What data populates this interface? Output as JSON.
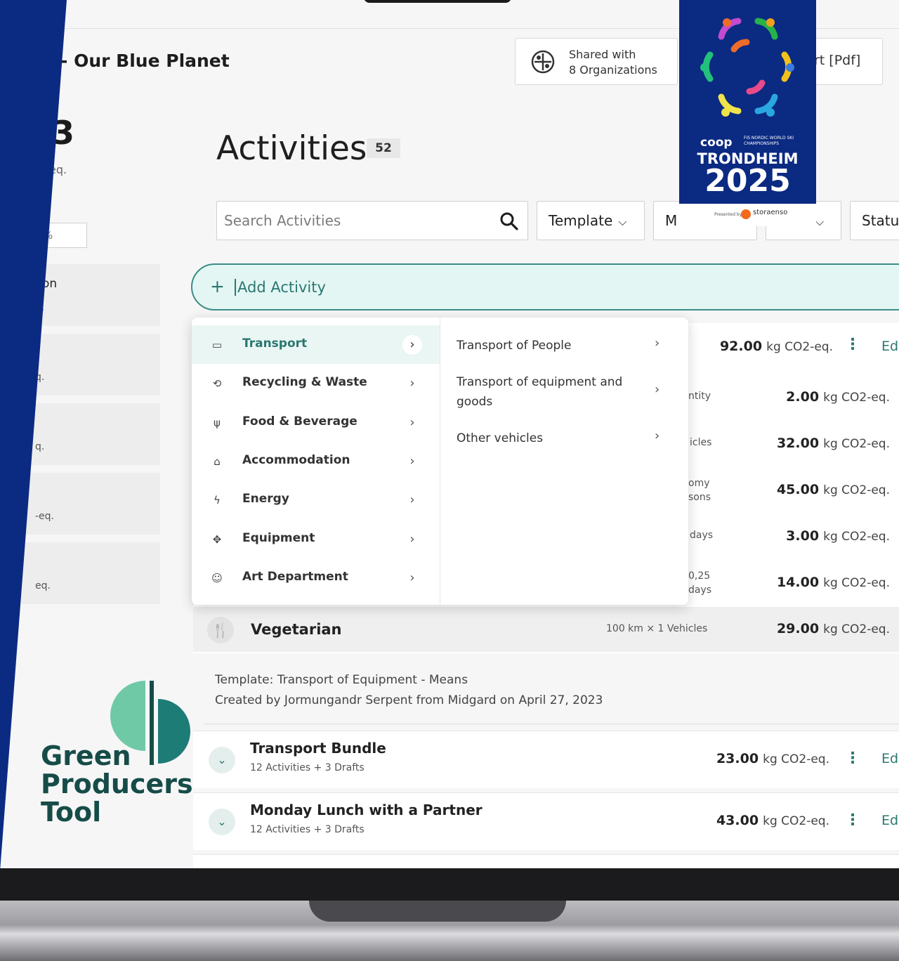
{
  "app": {
    "project_title": "- Our Blue Planet",
    "shared_line1": "Shared with",
    "shared_line2": "8 Organizations",
    "export_label": "rt [Pdf]"
  },
  "summary": {
    "big_number": "3",
    "unit": "eq.",
    "percent_box": "%",
    "cards": [
      {
        "title": "on",
        "sub": "q."
      },
      {
        "title": "",
        "sub": "q."
      },
      {
        "title": "",
        "sub": "q."
      },
      {
        "title": "",
        "sub": "-eq."
      },
      {
        "title": "",
        "sub": "eq."
      }
    ]
  },
  "activities": {
    "heading": "Activities",
    "count": "52",
    "search_placeholder": "Search Activities",
    "filters": {
      "template": "Template",
      "m": "M",
      "status": "Statu"
    },
    "add_label": "Add Activity",
    "header_row": {
      "value": "92.00",
      "unit": "kg CO2-eq.",
      "edit": "Ed"
    },
    "rows": [
      {
        "qty": "ntity",
        "value": "2.00",
        "unit": "kg CO2-eq."
      },
      {
        "qty": "icles",
        "value": "32.00",
        "unit": "kg CO2-eq."
      },
      {
        "qty": "omy\nsons",
        "value": "45.00",
        "unit": "kg CO2-eq."
      },
      {
        "qty": "days",
        "value": "3.00",
        "unit": "kg CO2-eq."
      },
      {
        "qty": "0,25\ndays",
        "value": "14.00",
        "unit": "kg CO2-eq."
      }
    ],
    "vegetarian": {
      "label": "Vegetarian",
      "qty": "100 km  × 1 Vehicles",
      "value": "29.00",
      "unit": "kg CO2-eq."
    },
    "template_info": {
      "line1": "Template: Transport of Equipment - Means",
      "line2": "Created by Jormungandr Serpent from Midgard on April 27, 2023"
    },
    "bundles": [
      {
        "title": "Transport Bundle",
        "sub": "12 Activities + 3 Drafts",
        "value": "23.00",
        "unit": "kg CO2-eq.",
        "edit": "Ed"
      },
      {
        "title": "Monday Lunch with a Partner",
        "sub": "12 Activities + 3 Drafts",
        "value": "43.00",
        "unit": "kg CO2-eq.",
        "edit": "Ed"
      }
    ]
  },
  "menu": {
    "categories": [
      {
        "label": "Transport",
        "icon": "bus-icon"
      },
      {
        "label": "Recycling & Waste",
        "icon": "recycle-icon"
      },
      {
        "label": "Food & Beverage",
        "icon": "cutlery-icon"
      },
      {
        "label": "Accommodation",
        "icon": "house-icon"
      },
      {
        "label": "Energy",
        "icon": "plug-icon"
      },
      {
        "label": "Equipment",
        "icon": "film-camera-icon"
      },
      {
        "label": "Art Department",
        "icon": "masks-icon"
      }
    ],
    "subcategories": [
      {
        "label": "Transport of People"
      },
      {
        "label": "Transport of equipment and goods"
      },
      {
        "label": "Other vehicles"
      }
    ]
  },
  "branding": {
    "gpt_line1": "Green",
    "gpt_line2": "Producers",
    "gpt_line3": "Tool",
    "trond_coop": "coop",
    "trond_fis": "FIS NORDIC WORLD SKI CHAMPIONSHIPS",
    "trond_city": "TRONDHEIM",
    "trond_year": "2025",
    "trond_presented": "Presented by",
    "trond_sponsor": "storaenso"
  },
  "colors": {
    "accent": "#2b7770",
    "banner_blue": "#0b2a82",
    "gpt_dark": "#164c48",
    "gpt_light": "#6fc9a6"
  }
}
